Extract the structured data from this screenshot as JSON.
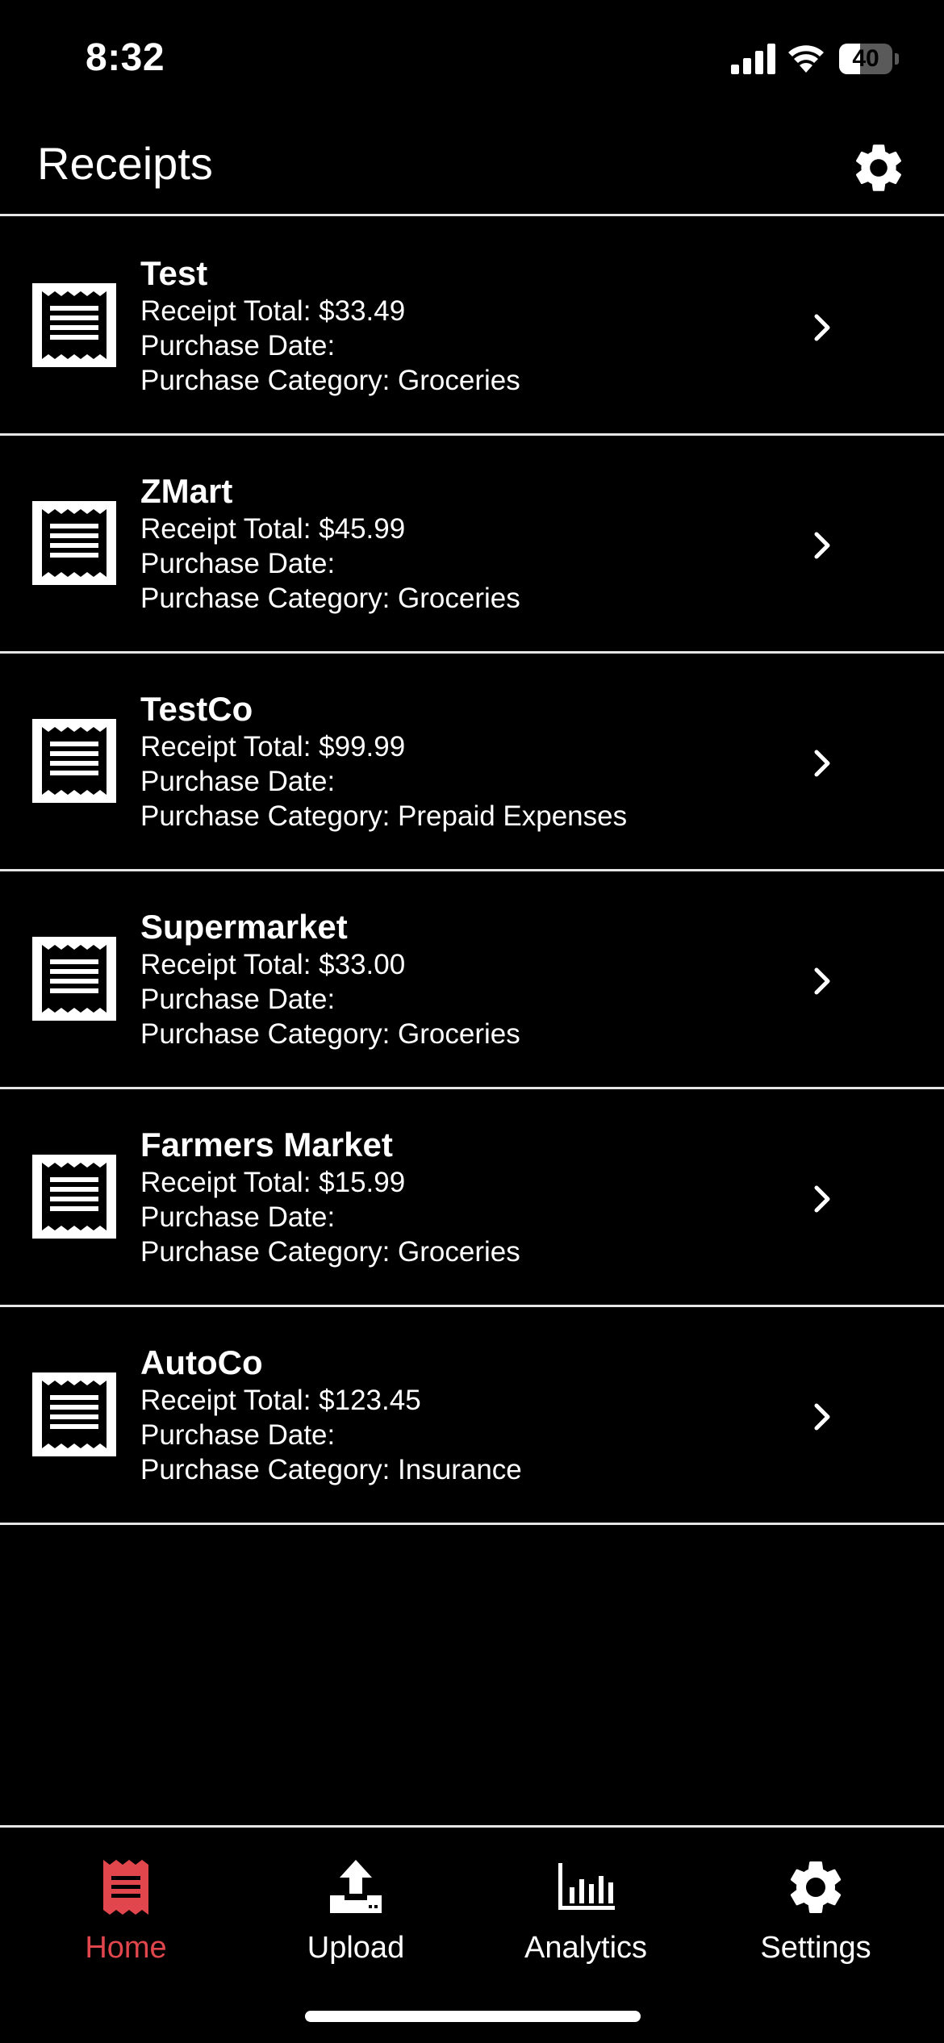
{
  "status_bar": {
    "time": "8:32",
    "battery_level": "40",
    "battery_fraction": 0.4
  },
  "header": {
    "title": "Receipts",
    "settings_icon": "gear-icon"
  },
  "receipts": [
    {
      "name": "Test",
      "total": "Receipt Total: $33.49",
      "date": "Purchase Date:",
      "category": "Purchase Category: Groceries"
    },
    {
      "name": "ZMart",
      "total": "Receipt Total: $45.99",
      "date": "Purchase Date:",
      "category": "Purchase Category: Groceries"
    },
    {
      "name": "TestCo",
      "total": "Receipt Total: $99.99",
      "date": "Purchase Date:",
      "category": "Purchase Category: Prepaid Expenses"
    },
    {
      "name": "Supermarket",
      "total": "Receipt Total: $33.00",
      "date": "Purchase Date:",
      "category": "Purchase Category: Groceries"
    },
    {
      "name": "Farmers Market",
      "total": "Receipt Total: $15.99",
      "date": "Purchase Date:",
      "category": "Purchase Category: Groceries"
    },
    {
      "name": "AutoCo",
      "total": "Receipt Total: $123.45",
      "date": "Purchase Date:",
      "category": "Purchase Category: Insurance"
    }
  ],
  "tabs": [
    {
      "label": "Home",
      "icon": "receipt-icon",
      "active": true
    },
    {
      "label": "Upload",
      "icon": "upload-icon",
      "active": false
    },
    {
      "label": "Analytics",
      "icon": "bar-chart-icon",
      "active": false
    },
    {
      "label": "Settings",
      "icon": "gear-icon",
      "active": false
    }
  ],
  "colors": {
    "background": "#000000",
    "text": "#ffffff",
    "divider": "#e6e6e6",
    "accent_active_tab": "#e0464c"
  }
}
